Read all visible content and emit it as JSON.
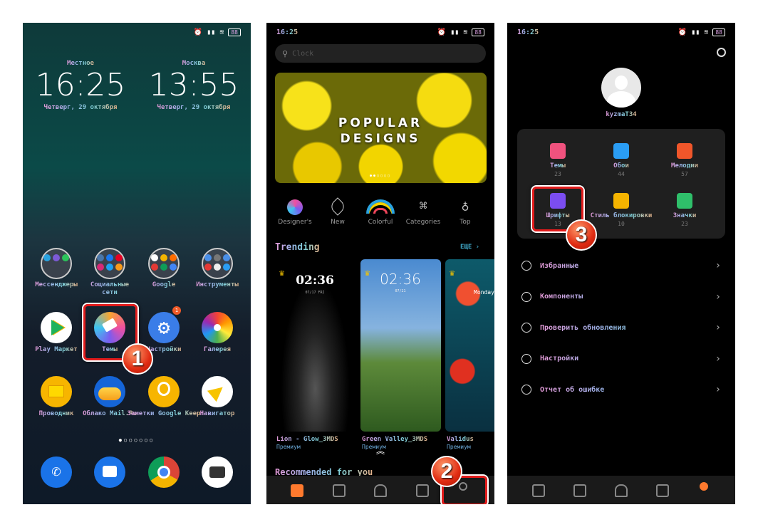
{
  "home": {
    "status_icons": [
      "alarm-icon",
      "signal-icon",
      "wifi-icon",
      "battery-icon"
    ],
    "battery": "88",
    "clocks": [
      {
        "city": "Местное",
        "time": "16:25",
        "date": "Четверг, 29 октября"
      },
      {
        "city": "Москва",
        "time": "13:55",
        "date": "Четверг, 29 октября"
      }
    ],
    "apps": [
      {
        "label": "Мессенджеры",
        "icon": "folder-icon"
      },
      {
        "label": "Социальные сети",
        "icon": "folder-icon"
      },
      {
        "label": "Google",
        "icon": "folder-icon"
      },
      {
        "label": "Инструменты",
        "icon": "folder-icon"
      },
      {
        "label": "Play Маркет",
        "icon": "play-store-icon"
      },
      {
        "label": "Темы",
        "icon": "themes-icon"
      },
      {
        "label": "Настройки",
        "icon": "settings-icon",
        "badge": "1"
      },
      {
        "label": "Галерея",
        "icon": "gallery-icon"
      },
      {
        "label": "Проводник",
        "icon": "file-manager-icon"
      },
      {
        "label": "Облако Mail.Ru",
        "icon": "cloud-icon"
      },
      {
        "label": "Заметки Google Keep",
        "icon": "keep-icon"
      },
      {
        "label": "Навигатор",
        "icon": "navigator-icon"
      }
    ],
    "dock": [
      "phone-icon",
      "messages-icon",
      "chrome-icon",
      "camera-icon"
    ],
    "step": "1"
  },
  "themes": {
    "time": "16:25",
    "search_placeholder": "Clock",
    "banner": "POPULAR DESIGNS",
    "categories": [
      "Designer's",
      "New",
      "Colorful",
      "Categories",
      "Top"
    ],
    "trending_title": "Trending",
    "more": "ЕЩЕ",
    "cards": [
      {
        "name": "Lion - Glow_3MDS",
        "tag": "Премиум",
        "time": "02:36",
        "date": "07/17 FRI"
      },
      {
        "name": "Green Valley_3MDS",
        "tag": "Премиум",
        "time": "02:36",
        "date": "07/21"
      },
      {
        "name": "Validus",
        "tag": "Премиум",
        "time": "",
        "date": "Monday"
      }
    ],
    "recommended": "Recommended for you",
    "step": "2"
  },
  "profile": {
    "time": "16:25",
    "username": "kyzmaT34",
    "grid": [
      {
        "label": "Темы",
        "count": "23",
        "color": "#f0527e"
      },
      {
        "label": "Обои",
        "count": "44",
        "color": "#2a9df4"
      },
      {
        "label": "Мелодии",
        "count": "57",
        "color": "#f0562a"
      },
      {
        "label": "Шрифты",
        "count": "13",
        "color": "#7b4df0"
      },
      {
        "label": "Стиль блокировки",
        "count": "10",
        "color": "#f5b400"
      },
      {
        "label": "Значки",
        "count": "23",
        "color": "#2fbf6a"
      }
    ],
    "menu": [
      "Избранные",
      "Компоненты",
      "Проверить обновления",
      "Настройки",
      "Отчет об ошибке"
    ],
    "step": "3"
  },
  "colors": {
    "accent": "#ff7a2e",
    "highlight": "#e21b1b"
  }
}
